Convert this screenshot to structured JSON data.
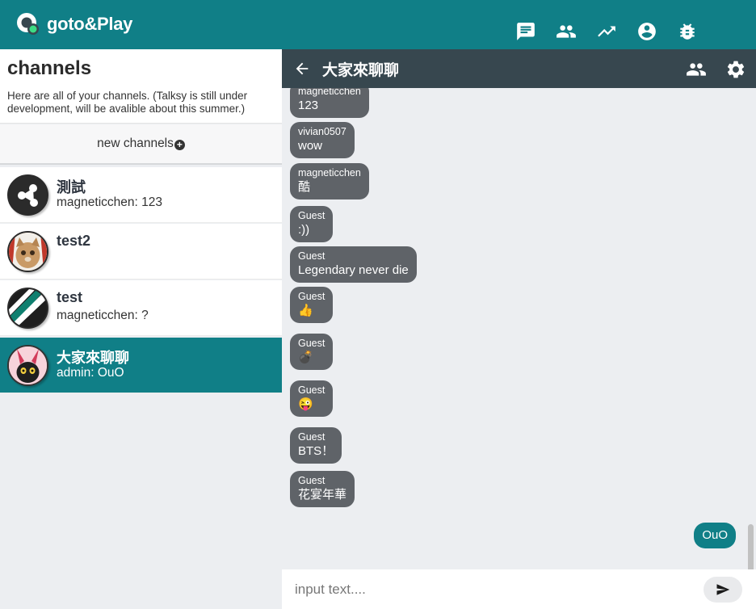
{
  "app": {
    "name": "goto&Play"
  },
  "nav": {
    "icons": [
      "chat-icon",
      "people-icon",
      "trending-icon",
      "account-icon",
      "bug-icon"
    ]
  },
  "channels_panel": {
    "title": "channels",
    "description": "Here are all of your channels. (Talksy is still under development, will be avalible about this summer.)",
    "new_channel_label": "new channels",
    "items": [
      {
        "name": "測試",
        "last": "magneticchen: 123",
        "active": false
      },
      {
        "name": "test2",
        "last": "",
        "active": false
      },
      {
        "name": "test",
        "last": "magneticchen: ?",
        "active": false
      },
      {
        "name": "大家來聊聊",
        "last": "admin: OuO",
        "active": true
      }
    ]
  },
  "chat": {
    "title": "大家來聊聊",
    "messages": [
      {
        "sender": "magneticchen",
        "text": "123"
      },
      {
        "sender": "vivian0507",
        "text": "wow"
      },
      {
        "sender": "magneticchen",
        "text": "酷"
      },
      {
        "sender": "Guest",
        "text": ":))"
      },
      {
        "sender": "Guest",
        "text": "Legendary never die"
      },
      {
        "sender": "Guest",
        "text": "👍"
      },
      {
        "sender": "Guest",
        "text": "💣"
      },
      {
        "sender": "Guest",
        "text": "😜"
      },
      {
        "sender": "Guest",
        "text": "BTS！"
      },
      {
        "sender": "Guest",
        "text": "花宴年華"
      }
    ],
    "own_message": "OuO",
    "input_placeholder": "input text...."
  },
  "colors": {
    "brand": "#107f87",
    "chat_header": "#37474f",
    "bubble": "#5f6368",
    "background": "#eceef1"
  }
}
